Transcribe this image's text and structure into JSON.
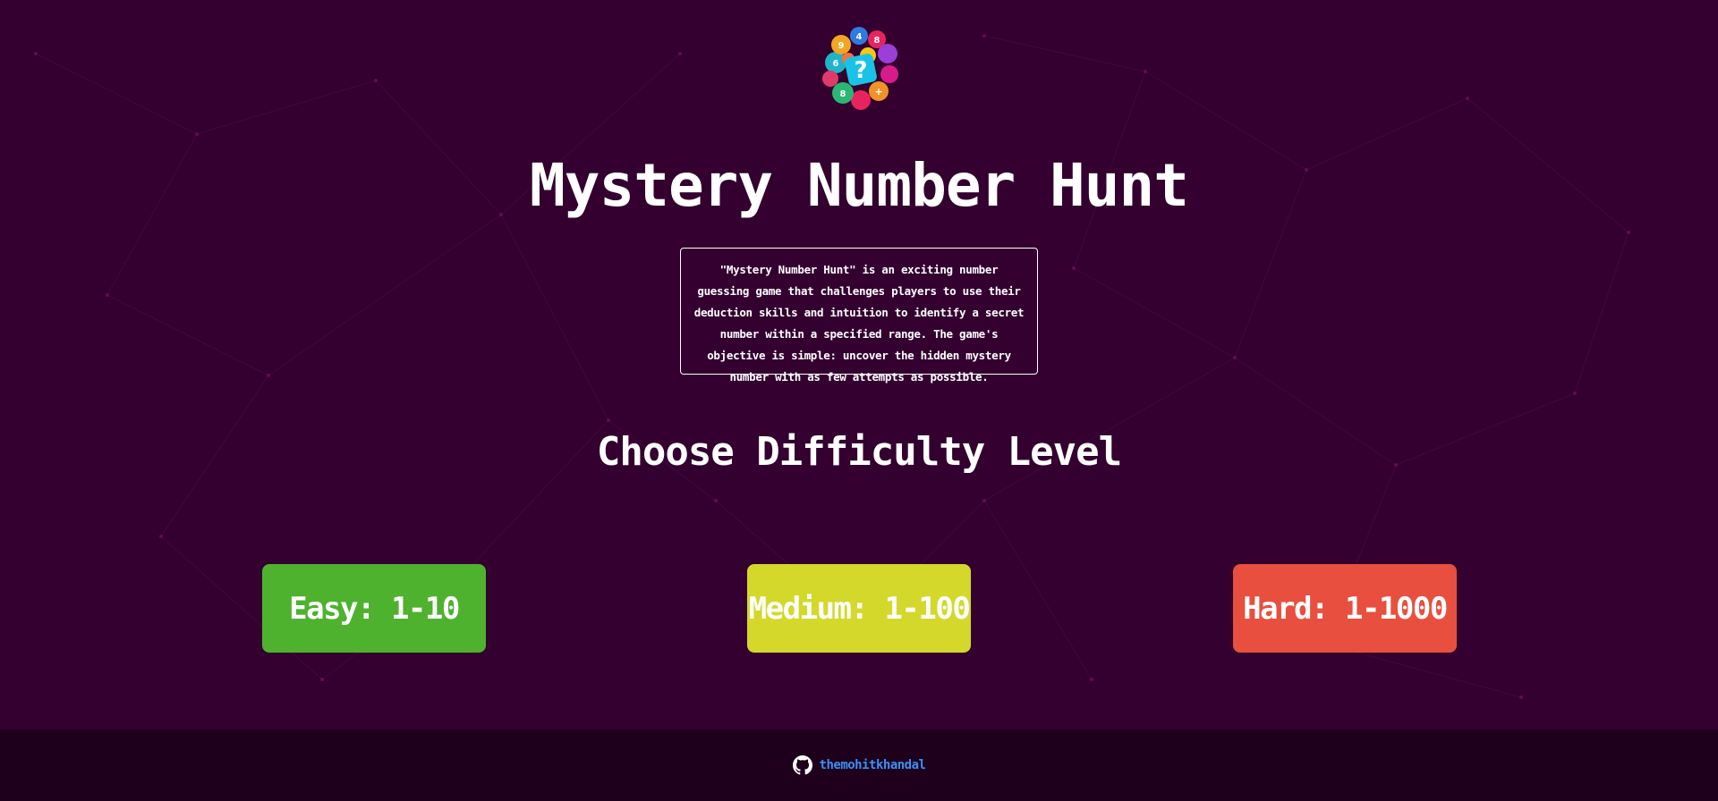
{
  "app": {
    "title": "Mystery Number Hunt",
    "description": "\"Mystery Number Hunt\" is an exciting number guessing game that challenges players to use their deduction skills and intuition to identify a secret number within a specified range. The game's objective is simple: uncover the hidden mystery number with as few attempts as possible.",
    "logo_icon": "number-bubbles-logo-icon"
  },
  "difficulty": {
    "heading": "Choose Difficulty Level",
    "levels": [
      {
        "label": "Easy: 1-10",
        "color": "#4eb22f"
      },
      {
        "label": "Medium: 1-100",
        "color": "#d4d82a"
      },
      {
        "label": "Hard: 1-1000",
        "color": "#e84f3e"
      }
    ]
  },
  "footer": {
    "icon": "github-icon",
    "username": "themohitkhandal",
    "link_color": "#3a8ff3"
  },
  "colors": {
    "background": "#33002f",
    "footer_background": "#1e001c",
    "text": "#ffffff"
  }
}
